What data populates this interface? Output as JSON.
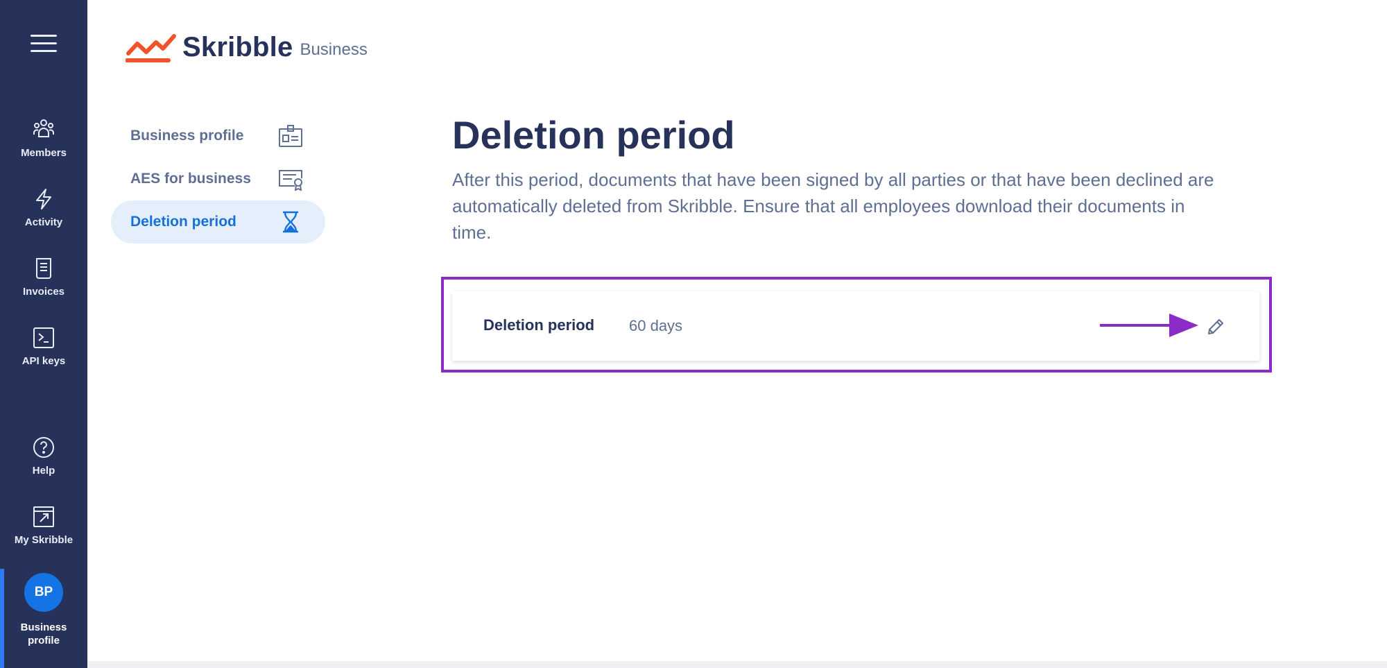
{
  "rail": {
    "menu_icon": "hamburger-menu-icon",
    "items": [
      {
        "label": "Members",
        "icon": "members-icon"
      },
      {
        "label": "Activity",
        "icon": "lightning-icon"
      },
      {
        "label": "Invoices",
        "icon": "invoice-icon"
      },
      {
        "label": "API keys",
        "icon": "terminal-icon"
      },
      {
        "label": "Help",
        "icon": "help-circle-icon"
      },
      {
        "label": "My Skribble",
        "icon": "external-link-icon"
      }
    ],
    "profile": {
      "initials": "BP",
      "label_line1": "Business",
      "label_line2": "profile"
    }
  },
  "logo": {
    "brand": "Skribble",
    "product": "Business"
  },
  "settings_nav": {
    "items": [
      {
        "label": "Business profile",
        "icon": "id-card-icon",
        "active": false
      },
      {
        "label": "AES for business",
        "icon": "certificate-icon",
        "active": false
      },
      {
        "label": "Deletion period",
        "icon": "hourglass-icon",
        "active": true
      }
    ]
  },
  "main": {
    "title": "Deletion period",
    "description": "After this period, documents that have been signed by all parties or that have been declined are automatically deleted from Skribble. Ensure that all employees download their documents in time.",
    "card": {
      "label": "Deletion period",
      "value": "60 days",
      "edit_icon": "pencil-icon"
    }
  },
  "colors": {
    "rail_bg": "#263259",
    "accent_blue": "#1670dc",
    "highlight": "#8b2cc8",
    "logo_orange": "#f0522a"
  }
}
